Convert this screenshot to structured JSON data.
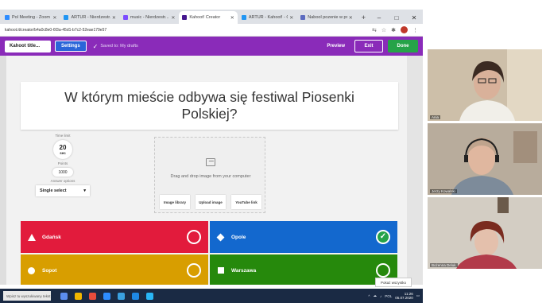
{
  "browser": {
    "tabs": [
      {
        "title": "Pol Meeting - Zoom",
        "active": false
      },
      {
        "title": "ARTUR - Nierdzestr...",
        "active": false
      },
      {
        "title": "music - Nierdzestr...",
        "active": false
      },
      {
        "title": "Kahoot! Creator",
        "active": true
      },
      {
        "title": "ARTUR - Kahoot! - Go...",
        "active": false
      },
      {
        "title": "Nabool pozenie w pro...",
        "active": false
      }
    ],
    "new_tab": "+",
    "window_controls": {
      "minimize": "–",
      "maximize": "□",
      "close": "✕"
    },
    "url": "kahoot.it/creator/b4a0c8e0-6f3a-45d1-b7c2-52eae179e57",
    "colors": {
      "brand": "#8a2bb9",
      "done": "#26a348",
      "settings": "#2b65d9"
    }
  },
  "toolbar": {
    "quiz_title": "Kahoot title...",
    "settings": "Settings",
    "saved": "Saved to: My drafts",
    "preview": "Preview",
    "exit": "Exit",
    "done": "Done"
  },
  "question": {
    "text": "W którym mieście odbywa się festiwal Piosenki Polskiej?"
  },
  "settings_panel": {
    "time_label": "Time limit",
    "time_value": "20",
    "time_unit": "sec",
    "points_label": "Points",
    "points_value": "1000",
    "answer_label": "Answer options",
    "answer_value": "Single select"
  },
  "media": {
    "drag_text": "Drag and drop image from your computer",
    "buttons": [
      "Image library",
      "Upload image",
      "YouTube link"
    ]
  },
  "answers": [
    {
      "text": "Gdańsk",
      "shape": "triangle",
      "color": "#e21b3c",
      "correct": false
    },
    {
      "text": "Opole",
      "shape": "diamond",
      "color": "#1368ce",
      "correct": true
    },
    {
      "text": "Sopot",
      "shape": "circle",
      "color": "#d89e00",
      "correct": false
    },
    {
      "text": "Warszawa",
      "shape": "square",
      "color": "#26890c",
      "correct": false
    }
  ],
  "zoom_toast": "Pokaż wszystko",
  "taskbar": {
    "search": "Wpisz tu wyszukiwany tekst",
    "lang": "POL",
    "time": "11:26",
    "date": "05.07.2020"
  },
  "participants": [
    {
      "name": "Ania"
    },
    {
      "name": "Jerzy Kowalski"
    },
    {
      "name": "Bożenna Deluk"
    }
  ]
}
